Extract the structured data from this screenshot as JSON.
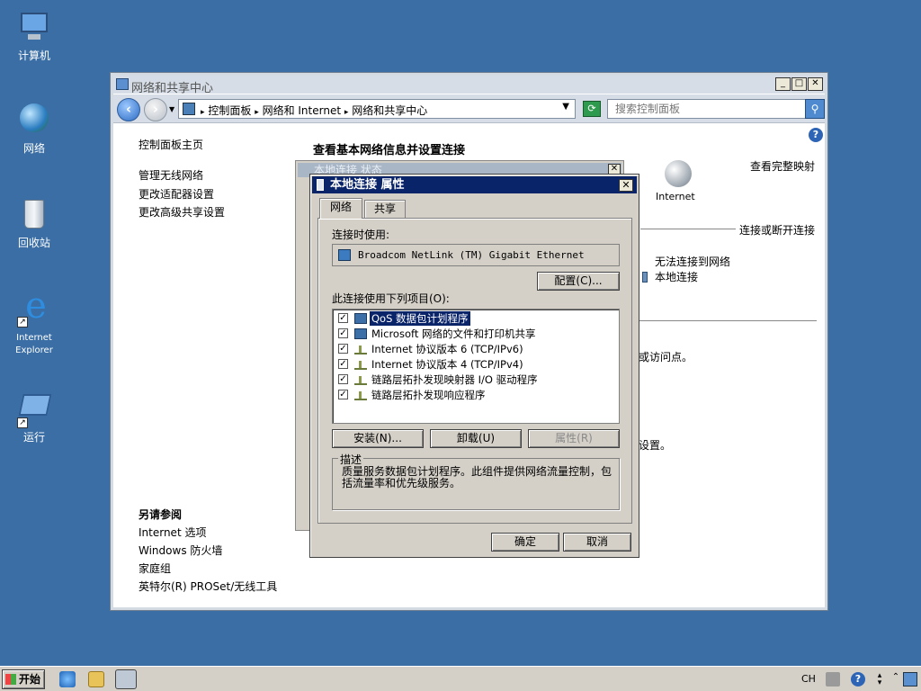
{
  "desktop": {
    "icons": [
      {
        "label": "计算机",
        "icon": "computer-icon"
      },
      {
        "label": "网络",
        "icon": "network-globe-icon"
      },
      {
        "label": "回收站",
        "icon": "recycle-bin-icon"
      },
      {
        "label": "Internet Explorer",
        "icon": "ie-icon"
      },
      {
        "label": "运行",
        "icon": "run-icon"
      }
    ]
  },
  "window": {
    "title": "网络和共享中心",
    "controls": {
      "minimize": "_",
      "maximize": "□",
      "close": "✕"
    },
    "address": {
      "crumb1": "控制面板",
      "crumb2": "网络和 Internet",
      "crumb3": "网络和共享中心",
      "sep": "▸"
    },
    "search_placeholder": "搜索控制面板"
  },
  "sidebar": {
    "home": "控制面板主页",
    "links": [
      "管理无线网络",
      "更改适配器设置",
      "更改高级共享设置"
    ],
    "see_also_title": "另请参阅",
    "see_also": [
      "Internet 选项",
      "Windows 防火墙",
      "家庭组",
      "英特尔(R) PROSet/无线工具"
    ]
  },
  "main": {
    "heading": "查看基本网络信息并设置连接",
    "view_full_map": "查看完整映射",
    "internet_label": "Internet",
    "connect_disconnect": "连接或断开连接",
    "no_network": "无法连接到网络",
    "local_connection": "本地连接",
    "frag1": "或访问点。",
    "frag2": "设置。"
  },
  "status_dialog": {
    "title": "本地连接 状态"
  },
  "props_dialog": {
    "title": "本地连接 属性",
    "tabs": [
      "网络",
      "共享"
    ],
    "connect_using_label": "连接时使用:",
    "adapter": "Broadcom NetLink (TM) Gigabit Ethernet",
    "configure": "配置(C)...",
    "items_label": "此连接使用下列项目(O):",
    "items": [
      {
        "label": "QoS 数据包计划程序",
        "checked": true,
        "icon": "component"
      },
      {
        "label": "Microsoft 网络的文件和打印机共享",
        "checked": true,
        "icon": "component"
      },
      {
        "label": "Internet 协议版本 6 (TCP/IPv6)",
        "checked": true,
        "icon": "protocol"
      },
      {
        "label": "Internet 协议版本 4 (TCP/IPv4)",
        "checked": true,
        "icon": "protocol"
      },
      {
        "label": "链路层拓扑发现映射器 I/O 驱动程序",
        "checked": true,
        "icon": "protocol"
      },
      {
        "label": "链路层拓扑发现响应程序",
        "checked": true,
        "icon": "protocol"
      }
    ],
    "install": "安装(N)...",
    "uninstall": "卸载(U)",
    "properties": "属性(R)",
    "desc_legend": "描述",
    "description": "质量服务数据包计划程序。此组件提供网络流量控制，包括流量率和优先级服务。",
    "ok": "确定",
    "cancel": "取消",
    "close": "✕"
  },
  "taskbar": {
    "start": "开始",
    "lang": "CH"
  }
}
